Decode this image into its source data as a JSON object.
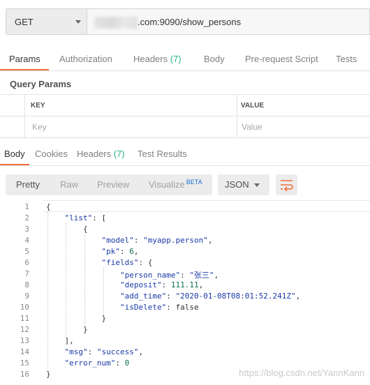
{
  "request": {
    "method": "GET",
    "url_visible": ".com:9090/show_persons"
  },
  "request_tabs": [
    {
      "label": "Params",
      "count": ""
    },
    {
      "label": "Authorization",
      "count": ""
    },
    {
      "label": "Headers ",
      "count": "(7)"
    },
    {
      "label": "Body",
      "count": ""
    },
    {
      "label": "Pre-request Script",
      "count": ""
    },
    {
      "label": "Tests",
      "count": ""
    }
  ],
  "query_params": {
    "title": "Query Params",
    "col_key": "KEY",
    "col_value": "VALUE",
    "key_placeholder": "Key",
    "value_placeholder": "Value"
  },
  "response_tabs": [
    {
      "label": "Body",
      "count": ""
    },
    {
      "label": "Cookies",
      "count": ""
    },
    {
      "label": "Headers ",
      "count": "(7)"
    },
    {
      "label": "Test Results",
      "count": ""
    }
  ],
  "view_modes": {
    "pretty": "Pretty",
    "raw": "Raw",
    "preview": "Preview",
    "visualize": "Visualize",
    "beta": "BETA"
  },
  "format_select": "JSON",
  "code_lines": [
    {
      "n": "1",
      "text": "{"
    },
    {
      "n": "2",
      "text": "    \"list\": ["
    },
    {
      "n": "3",
      "text": "        {"
    },
    {
      "n": "4",
      "text": "            \"model\": \"myapp.person\","
    },
    {
      "n": "5",
      "text": "            \"pk\": 6,"
    },
    {
      "n": "6",
      "text": "            \"fields\": {"
    },
    {
      "n": "7",
      "text": "                \"person_name\": \"张三\","
    },
    {
      "n": "8",
      "text": "                \"deposit\": 111.11,"
    },
    {
      "n": "9",
      "text": "                \"add_time\": \"2020-01-08T08:01:52.241Z\","
    },
    {
      "n": "10",
      "text": "                \"isDelete\": false"
    },
    {
      "n": "11",
      "text": "            }"
    },
    {
      "n": "12",
      "text": "        }"
    },
    {
      "n": "13",
      "text": "    ],"
    },
    {
      "n": "14",
      "text": "    \"msg\": \"success\","
    },
    {
      "n": "15",
      "text": "    \"error_num\": 0"
    },
    {
      "n": "16",
      "text": "}"
    }
  ],
  "watermark": "https://blog.csdn.net/YannKann",
  "colors": {
    "accent": "#f26b3a",
    "count_green": "#26b47f",
    "beta_blue": "#1a6fd1"
  },
  "icons": {
    "method_dropdown": "chevron-down-icon",
    "format_dropdown": "chevron-down-icon",
    "wrap": "wrap-lines-icon"
  }
}
